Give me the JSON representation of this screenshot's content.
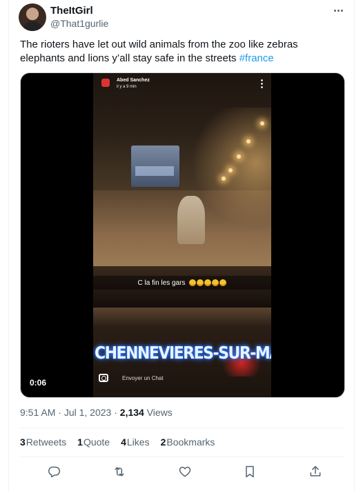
{
  "author": {
    "display_name": "TheItGirl",
    "handle": "@That1gurlie"
  },
  "tweet": {
    "text_main": "The rioters have let out wild animals from the zoo like zebras elephants and lions y’all stay safe in the streets ",
    "hashtag": "#france"
  },
  "media": {
    "duration": "0:06",
    "overlay": {
      "snap_user": "Abed Sanchez",
      "snap_time": "il y a 9 min",
      "caption": "C la fin les gars",
      "location": "CHENNEVIERES-SUR-MARNE",
      "chat_prompt": "Envoyer un Chat"
    }
  },
  "meta": {
    "time": "9:51 AM",
    "separator1": " · ",
    "date": "Jul 1, 2023",
    "separator2": " · ",
    "views_count": "2,134",
    "views_label": " Views"
  },
  "stats": {
    "retweets_count": "3",
    "retweets_label": "Retweets",
    "quotes_count": "1",
    "quotes_label": "Quote",
    "likes_count": "4",
    "likes_label": "Likes",
    "bookmarks_count": "2",
    "bookmarks_label": "Bookmarks"
  },
  "icons": [
    "more-icon",
    "reply-icon",
    "retweet-icon",
    "like-icon",
    "bookmark-icon",
    "share-icon"
  ],
  "colors": {
    "link": "#1d9bf0",
    "secondary_text": "#536471",
    "primary_text": "#0f1419"
  }
}
